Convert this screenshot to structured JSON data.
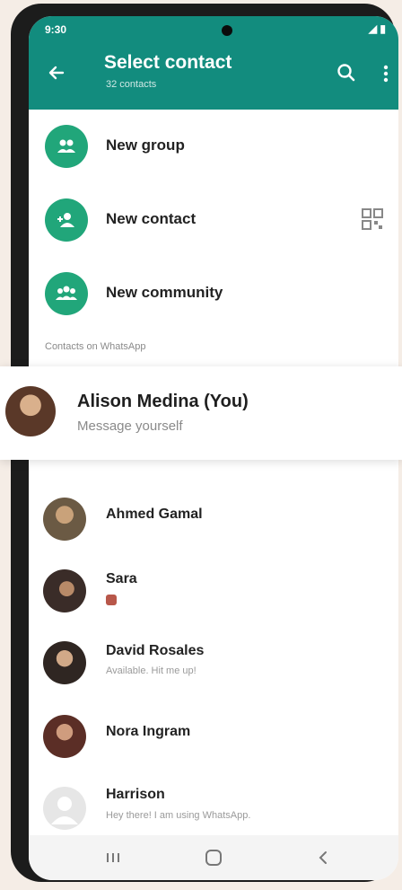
{
  "status_bar": {
    "time": "9:30",
    "icons": "◢ ▮"
  },
  "header": {
    "title": "Select contact",
    "subtitle": "32 contacts",
    "icons": [
      "back-arrow-icon",
      "search-icon",
      "more-vert-icon"
    ],
    "color": "#128c7e"
  },
  "actions": [
    {
      "label": "New group",
      "icon": "group-icon"
    },
    {
      "label": "New contact",
      "icon": "add-person-icon",
      "trailing_icon": "qr-code-icon"
    },
    {
      "label": "New community",
      "icon": "community-icon"
    }
  ],
  "section_label": "Contacts on WhatsApp",
  "self_contact": {
    "name": "Alison Medina (You)",
    "status": "Message yourself"
  },
  "contacts": [
    {
      "name": "Ahmed Gamal",
      "status": ""
    },
    {
      "name": "Sara",
      "status": ""
    },
    {
      "name": "David Rosales",
      "status": "Available. Hit me up!"
    },
    {
      "name": "Nora Ingram",
      "status": ""
    },
    {
      "name": "Harrison",
      "status": "Hey there! I am using WhatsApp."
    }
  ],
  "nav_bar": {
    "icons": [
      "recents-icon",
      "home-icon",
      "back-icon"
    ]
  },
  "colors": {
    "accent": "#21a67a",
    "header": "#128c7e"
  }
}
